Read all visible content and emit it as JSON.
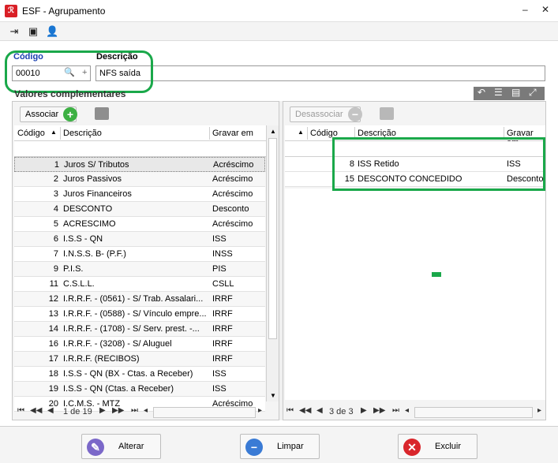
{
  "window": {
    "title": "ESF - Agrupamento",
    "minimize": "‒",
    "close": "✕",
    "app_icon": "ℛ"
  },
  "toolbar": {
    "icons": [
      "exit-icon",
      "card-icon",
      "user-icon"
    ]
  },
  "form": {
    "codigo_label": "Código",
    "descricao_label": "Descrição",
    "codigo_value": "00010",
    "descricao_value": "NFS saída",
    "search_glyph": "🔍",
    "plus_glyph": "+"
  },
  "section_title": "Valores complementares",
  "left": {
    "associate_label": "Associar",
    "headers": {
      "codigo": "Código",
      "descricao": "Descrição",
      "gravar": "Gravar em"
    },
    "rows": [
      {
        "code": "1",
        "desc": "Juros S/ Tributos",
        "grav": "Acréscimo"
      },
      {
        "code": "2",
        "desc": "Juros Passivos",
        "grav": "Acréscimo"
      },
      {
        "code": "3",
        "desc": "Juros Financeiros",
        "grav": "Acréscimo"
      },
      {
        "code": "4",
        "desc": "DESCONTO",
        "grav": "Desconto"
      },
      {
        "code": "5",
        "desc": "ACRESCIMO",
        "grav": "Acréscimo"
      },
      {
        "code": "6",
        "desc": "I.S.S - QN",
        "grav": "ISS"
      },
      {
        "code": "7",
        "desc": "I.N.S.S. B- (P.F.)",
        "grav": "INSS"
      },
      {
        "code": "9",
        "desc": "P.I.S.",
        "grav": "PIS"
      },
      {
        "code": "11",
        "desc": "C.S.L.L.",
        "grav": "CSLL"
      },
      {
        "code": "12",
        "desc": "I.R.R.F. - (0561) - S/ Trab. Assalari...",
        "grav": "IRRF"
      },
      {
        "code": "13",
        "desc": "I.R.R.F. - (0588) - S/ Vínculo empre...",
        "grav": "IRRF"
      },
      {
        "code": "14",
        "desc": "I.R.R.F. - (1708) - S/ Serv. prest. -...",
        "grav": "IRRF"
      },
      {
        "code": "16",
        "desc": "I.R.R.F. - (3208) - S/ Aluguel",
        "grav": "IRRF"
      },
      {
        "code": "17",
        "desc": "I.R.R.F. (RECIBOS)",
        "grav": "IRRF"
      },
      {
        "code": "18",
        "desc": "I.S.S - QN (BX - Ctas. a Receber)",
        "grav": "ISS"
      },
      {
        "code": "19",
        "desc": "I.S.S - QN (Ctas. a Receber)",
        "grav": "ISS"
      },
      {
        "code": "20",
        "desc": "I.C.M.S. - MTZ",
        "grav": "Acréscimo"
      }
    ],
    "pager": "1 de 19"
  },
  "right": {
    "disassociate_label": "Desassociar",
    "headers": {
      "codigo": "Código",
      "descricao": "Descrição",
      "gravar": "Gravar em"
    },
    "rows": [
      {
        "code": "8",
        "desc": "ISS Retido",
        "grav": "ISS"
      },
      {
        "code": "15",
        "desc": "DESCONTO CONCEDIDO",
        "grav": "Desconto"
      }
    ],
    "pager": "3 de 3"
  },
  "footer": {
    "alterar": "Alterar",
    "limpar": "Limpar",
    "excluir": "Excluir"
  },
  "colors": {
    "highlight": "#1aa84a",
    "associate": "#3cb043",
    "cancel": "#d9262c",
    "edit": "#7b68c9",
    "clear": "#3a7bd5"
  }
}
